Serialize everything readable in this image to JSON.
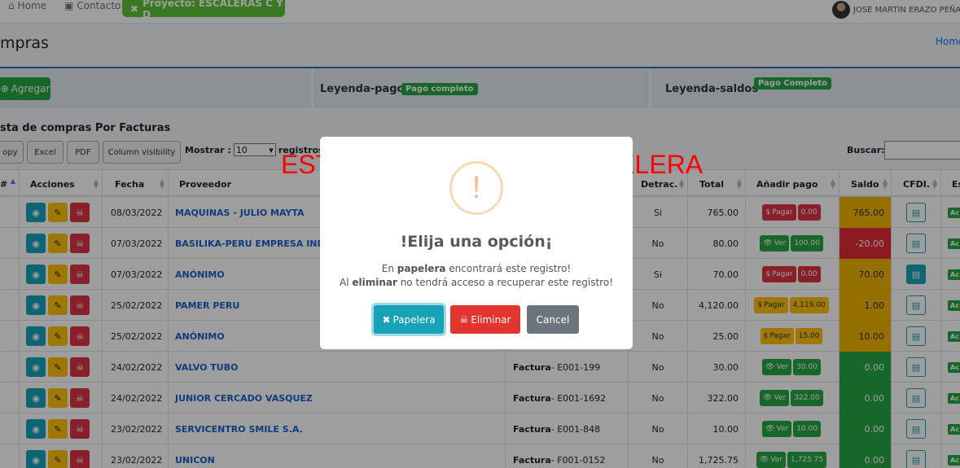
{
  "nav": {
    "home": "Home",
    "contacto": "Contacto",
    "project": "Proyecto: ESCALERAS C Y D",
    "user": "JOSE MARTIN ERAZO PEÑA"
  },
  "page": {
    "title": "mpras",
    "breadcrumb": "Home"
  },
  "legend": {
    "add": "Agregar",
    "pago_label": "Leyenda-pago",
    "pago_badge": "Pago completo",
    "saldos_label": "Leyenda-saldos",
    "saldos_badge": "Pago Completo"
  },
  "list": {
    "title": "sta de compras Por Facturas",
    "copy": "opy",
    "excel": "Excel",
    "pdf": "PDF",
    "colvis": "Column visibility",
    "mostrar": "Mostrar :",
    "mostrar_value": "10",
    "registros": "registros",
    "buscar": "Buscar:"
  },
  "columns": {
    "num": "#",
    "acciones": "Acciones",
    "fecha": "Fecha",
    "proveedor": "Proveedor",
    "detrac": "Detrac.",
    "total": "Total",
    "anadir": "Añadir pago",
    "saldo": "Saldo",
    "cfdi": "CFDI.",
    "estado": "Es"
  },
  "rows": [
    {
      "fecha": "08/03/2022",
      "proveedor": "MAQUINAS - JULIO MAYTA",
      "doc_type": "",
      "doc_num": "",
      "detrac": "Si",
      "total": "765.00",
      "pay_label": "Pagar",
      "pay_amount": "0.00",
      "saldo": "765.00",
      "estado": "Ac"
    },
    {
      "fecha": "07/03/2022",
      "proveedor": "BASILIKA-PERU EMPRESA INDIVIDUAL",
      "doc_type": "",
      "doc_num": "",
      "detrac": "No",
      "total": "80.00",
      "pay_label": "Ver",
      "pay_amount": "100.00",
      "saldo": "-20.00",
      "estado": "Ac"
    },
    {
      "fecha": "07/03/2022",
      "proveedor": "ANÓNIMO",
      "doc_type": "",
      "doc_num": "",
      "detrac": "Si",
      "total": "70.00",
      "pay_label": "Pagar",
      "pay_amount": "0.00",
      "saldo": "70.00",
      "estado": "Ac"
    },
    {
      "fecha": "25/02/2022",
      "proveedor": "PAMER PERU",
      "doc_type": "",
      "doc_num": "",
      "detrac": "No",
      "total": "4,120.00",
      "pay_label": "Pagar",
      "pay_amount": "4,119.00",
      "saldo": "1.00",
      "estado": "Ac"
    },
    {
      "fecha": "25/02/2022",
      "proveedor": "ANÓNIMO",
      "doc_type": "",
      "doc_num": "",
      "detrac": "No",
      "total": "25.00",
      "pay_label": "Pagar",
      "pay_amount": "15.00",
      "saldo": "10.00",
      "estado": "Ac"
    },
    {
      "fecha": "24/02/2022",
      "proveedor": "VALVO TUBO",
      "doc_type": "Factura",
      "doc_num": " - E001-199",
      "detrac": "No",
      "total": "30.00",
      "pay_label": "Ver",
      "pay_amount": "30.00",
      "saldo": "0.00",
      "estado": "Ac"
    },
    {
      "fecha": "24/02/2022",
      "proveedor": "JUNIOR CERCADO VASQUEZ",
      "doc_type": "Factura",
      "doc_num": " - E001-1692",
      "detrac": "No",
      "total": "322.00",
      "pay_label": "Ver",
      "pay_amount": "322.00",
      "saldo": "0.00",
      "estado": "Ac"
    },
    {
      "fecha": "23/02/2022",
      "proveedor": "SERVICENTRO SMILE S.A.",
      "doc_type": "Factura",
      "doc_num": " - E001-848",
      "detrac": "No",
      "total": "10.00",
      "pay_label": "Ver",
      "pay_amount": "10.00",
      "saldo": "0.00",
      "estado": "Ac"
    },
    {
      "fecha": "23/02/2022",
      "proveedor": "UNICON",
      "doc_type": "Factura",
      "doc_num": " - F001-0152",
      "detrac": "No",
      "total": "1,725.75",
      "pay_label": "Ver",
      "pay_amount": "1,725.75",
      "saldo": "0.00",
      "estado": "Ac"
    }
  ],
  "row_styles": [
    {
      "pay": "red",
      "saldo_color": "#f0b400",
      "cfdi_filled": false
    },
    {
      "pay": "green",
      "saldo_color": "#e32b36",
      "cfdi_filled": false
    },
    {
      "pay": "red",
      "saldo_color": "#f0b400",
      "cfdi_filled": true
    },
    {
      "pay": "yellow",
      "saldo_color": "#f0b400",
      "cfdi_filled": false
    },
    {
      "pay": "yellow",
      "saldo_color": "#f0b400",
      "cfdi_filled": false
    },
    {
      "pay": "green",
      "saldo_color": "#28a745",
      "cfdi_filled": false
    },
    {
      "pay": "green",
      "saldo_color": "#28a745",
      "cfdi_filled": false
    },
    {
      "pay": "green",
      "saldo_color": "#28a745",
      "cfdi_filled": false
    },
    {
      "pay": "green",
      "saldo_color": "#28a745",
      "cfdi_filled": false
    }
  ],
  "annotation": "ESTE QUEDA PARA LA PAPELERA",
  "modal": {
    "icon": "!",
    "title": "!Elija una opción¡",
    "line1_pre": "En ",
    "line1_bold": "papelera",
    "line1_post": " encontrará este registro!",
    "line2_pre": "Al ",
    "line2_bold": "eliminar",
    "line2_post": " no tendrá acceso a recuperar este registro!",
    "papelera": "Papelera",
    "eliminar": "Eliminar",
    "cancel": "Cancel"
  }
}
